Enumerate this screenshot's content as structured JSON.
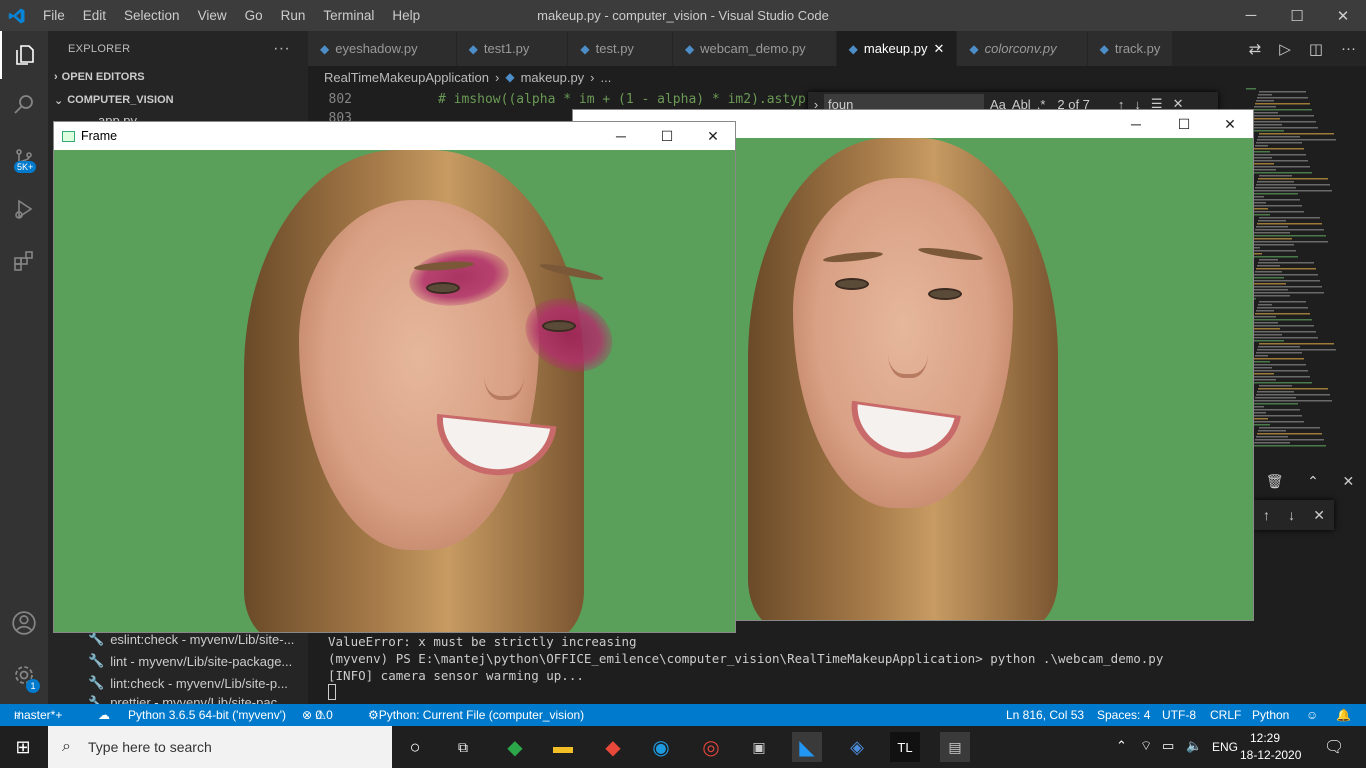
{
  "titlebar": {
    "menus": [
      "File",
      "Edit",
      "Selection",
      "View",
      "Go",
      "Run",
      "Terminal",
      "Help"
    ],
    "title": "makeup.py - computer_vision - Visual Studio Code"
  },
  "activity": {
    "source_badge": "5K+",
    "settings_badge": "1"
  },
  "sidebar": {
    "header": "EXPLORER",
    "open_editors": "OPEN EDITORS",
    "folder": "COMPUTER_VISION",
    "first_file": "app.py",
    "tasks": [
      "eslint:check - myvenv/Lib/site-...",
      "lint - myvenv/Lib/site-package...",
      "lint:check - myvenv/Lib/site-p...",
      "prettier - myvenv/Lib/site-pac..."
    ]
  },
  "tabs": [
    {
      "label": "eyeshadow.py"
    },
    {
      "label": "test1.py"
    },
    {
      "label": "test.py"
    },
    {
      "label": "webcam_demo.py"
    },
    {
      "label": "makeup.py",
      "active": true
    },
    {
      "label": "colorconv.py"
    },
    {
      "label": "track.py"
    }
  ],
  "breadcrumb": {
    "folder": "RealTimeMakeupApplication",
    "file": "makeup.py",
    "more": "..."
  },
  "editor": {
    "lines": [
      {
        "no": "802",
        "code": "# imshow((alpha * im + (1 - alpha) * im2).astyp"
      },
      {
        "no": "803",
        "code": ""
      }
    ]
  },
  "find": {
    "value": "foun",
    "count": "2 of 7",
    "case": "Aa",
    "word": "Abl",
    "regex": ".*"
  },
  "terminal": {
    "lines": [
      "ValueError: x must be strictly increasing",
      "(myvenv) PS E:\\mantej\\python\\OFFICE_emilence\\computer_vision\\RealTimeMakeupApplication> python .\\webcam_demo.py",
      "[INFO] camera sensor warming up..."
    ]
  },
  "frame_window": {
    "title": "Frame"
  },
  "second_window": {
    "title": "..."
  },
  "status": {
    "branch": "master*+",
    "python": "Python 3.6.5 64-bit ('myvenv')",
    "errors": "0",
    "warnings": "0",
    "run": "Python: Current File (computer_vision)",
    "position": "Ln 816, Col 53",
    "spaces": "Spaces: 4",
    "encoding": "UTF-8",
    "eol": "CRLF",
    "language": "Python"
  },
  "taskbar": {
    "search_placeholder": "Type here to search",
    "lang": "ENG",
    "time": "12:29",
    "date": "18-12-2020"
  },
  "colors": {
    "accent": "#007acc",
    "green_screen": "#5aa05a",
    "eyeshadow": "#a0205a"
  }
}
